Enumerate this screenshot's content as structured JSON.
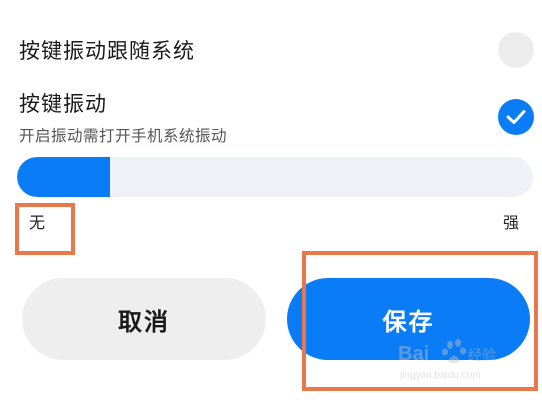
{
  "settings": {
    "follow_system": {
      "title": "按键振动跟随系统",
      "enabled": false
    },
    "key_vibration": {
      "title": "按键振动",
      "subtitle": "开启振动需打开手机系统振动",
      "enabled": true,
      "toggle_icon": "checkmark-icon"
    }
  },
  "intensity_slider": {
    "min_label": "无",
    "max_label": "强",
    "value_fraction": 0.18
  },
  "buttons": {
    "cancel_label": "取消",
    "save_label": "保存"
  },
  "colors": {
    "accent": "#0a7cf6",
    "highlight": "#e8774a",
    "track": "#eef1f6",
    "button_gray": "#eeeeee"
  },
  "watermark": {
    "brand": "Baidu"
  }
}
